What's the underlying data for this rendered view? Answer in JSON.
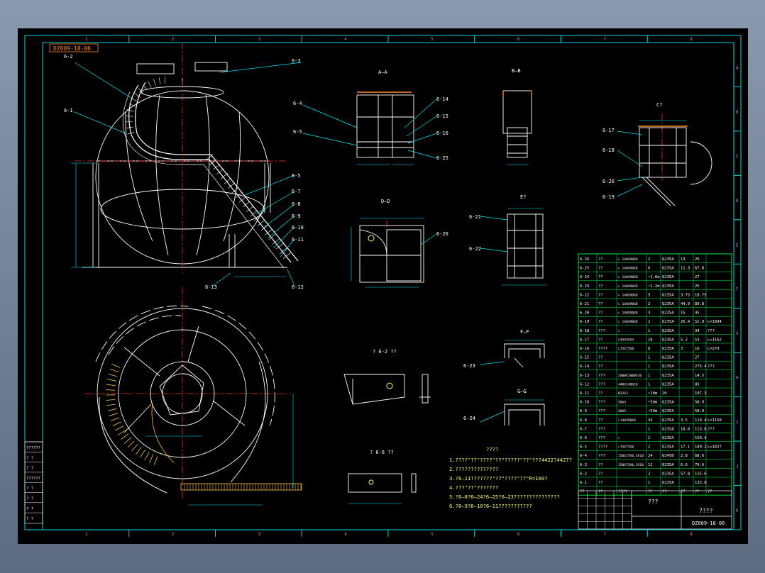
{
  "drawing": {
    "number": "DZ009-18-06",
    "title_main": "???",
    "title_sub": "????",
    "border_letters_right": [
      "A",
      "B",
      "C",
      "D",
      "E",
      "F",
      "G",
      "H",
      "I",
      "J",
      "K"
    ],
    "border_numbers_top": [
      "1",
      "2",
      "3",
      "4",
      "5",
      "6",
      "7",
      "8"
    ]
  },
  "views": {
    "aa": "A—A",
    "bb": "B—B",
    "c": "C?",
    "dd": "D—D",
    "e": "E?",
    "ff": "F—F",
    "gg": "G—G",
    "part62": "? 6-2   ??",
    "part66": "? 6-6   ??"
  },
  "callouts": {
    "main": [
      "6-2",
      "6-1",
      "6-3",
      "6-5",
      "6-7",
      "6-8",
      "6-9",
      "6-10",
      "6-11",
      "6-12",
      "6-13"
    ],
    "aa": [
      "6-4",
      "6-5",
      "6-14",
      "6-15",
      "6-16",
      "6-25"
    ],
    "c": [
      "6-17",
      "6-18",
      "6-26",
      "6-19"
    ],
    "dd": [
      "6-20"
    ],
    "e": [
      "6-21",
      "6-22"
    ],
    "ff": [
      "6-23"
    ],
    "gg": [
      "6-24"
    ]
  },
  "notes": {
    "heading": "????",
    "lines": [
      "1.????\"??\"????\"??\"?????\"??\"???4422?4427?",
      "2.??????????????",
      "3.?6—11???????\"??\"????\"??\"R=100?",
      "4.???\"??\"???????",
      "5.?6—8?6—24?6—25?6—23???????????????",
      "6.?6—9?6—10?6—11???????????"
    ]
  },
  "bom": {
    "rows": [
      [
        "6-26",
        "??",
        "∟ 140X90X8",
        "2",
        "Q235A",
        "13",
        "26",
        ""
      ],
      [
        "6-25",
        "??",
        "∟ 140X90X8",
        "6",
        "Q235A",
        "11.3",
        "67.8",
        ""
      ],
      [
        "6-24",
        "??",
        "∟ 140X90X8",
        "~1.6m",
        "Q235A",
        "",
        "27",
        ""
      ],
      [
        "6-23",
        "??",
        "∟ 140X90X8",
        "~1.2m",
        "Q235A",
        "",
        "25",
        ""
      ],
      [
        "6-22",
        "??",
        "∟ 140X90X8",
        "5",
        "Q235A",
        "3.75",
        "18.75",
        ""
      ],
      [
        "6-21",
        "??",
        "∟ 140X90X8",
        "2",
        "Q235A",
        "44.9",
        "89.8",
        ""
      ],
      [
        "6-20",
        "??",
        "∟ 140X90X8",
        "3",
        "Q235A",
        "15",
        "45",
        ""
      ],
      [
        "6-19",
        "??",
        "∟ 140X90X8",
        "2",
        "Q235A",
        "26.4",
        "52.8",
        "L=1894"
      ],
      [
        "6-18",
        "???",
        "∟",
        "1",
        "Q235A",
        "",
        "34",
        "???"
      ],
      [
        "6-17",
        "??",
        "∟45X45X4",
        "18",
        "Q235A",
        "5.2",
        "53",
        "L=1162"
      ],
      [
        "6-16",
        "????",
        "∟75X75X6",
        "8",
        "Q235A",
        "3",
        "16",
        "L=279"
      ],
      [
        "6-15",
        "??",
        "",
        "1",
        "Q235A",
        "",
        "27",
        ""
      ],
      [
        "6-14",
        "??",
        "",
        "1",
        "Q235A",
        "",
        "275.4",
        "???"
      ],
      [
        "6-13",
        "???",
        "2000X1000X10",
        "1",
        "Q235A",
        "",
        "14.5",
        ""
      ],
      [
        "6-12",
        "???",
        "440X140X10",
        "1",
        "Q235A",
        "",
        "83",
        ""
      ],
      [
        "6-11",
        "??",
        "Ø32X3",
        "~28m",
        "20",
        "",
        "107.3",
        ""
      ],
      [
        "6-10",
        "???",
        "50X5",
        "~50m",
        "Q235A",
        "",
        "58.9",
        ""
      ],
      [
        "6-9",
        "???",
        "50X5",
        "~50m",
        "Q235A",
        "",
        "58.9",
        ""
      ],
      [
        "6-8",
        "??",
        "∟140X90X8",
        "34",
        "Q235A",
        "3.5",
        "119.4",
        "L=1150"
      ],
      [
        "6-7",
        "???",
        "",
        "1",
        "Q235A",
        "18.8",
        "113.8",
        "???"
      ],
      [
        "6-6",
        "???",
        "∟",
        "1",
        "Q235A",
        "",
        "150.4",
        ""
      ],
      [
        "6-5",
        "????",
        "∟75X75X6",
        "2",
        "Q235A",
        "17.1",
        "189.2",
        "L=1827"
      ],
      [
        "6-4",
        "???",
        "150X75X6.5X10",
        "24",
        "Q345B",
        "2.8",
        "68.6",
        ""
      ],
      [
        "6-3",
        "??",
        "150X75X6.5X10",
        "12",
        "Q235A",
        "6.6",
        "79.6",
        ""
      ],
      [
        "6-2",
        "??",
        "",
        "2",
        "Q235A",
        "57.8",
        "115.6",
        ""
      ],
      [
        "6-1",
        "??",
        "",
        "1",
        "Q235A",
        "",
        "133.8",
        ""
      ]
    ],
    "header": [
      "??",
      "??",
      "????",
      "??",
      "??",
      "??",
      "??",
      "??"
    ]
  },
  "left_title_strip": [
    "??????",
    "? ?",
    "? ?",
    "??????",
    "? ?",
    "? ?",
    "? ?",
    "? ?"
  ],
  "colors": {
    "line": "#ffffff",
    "center": "#ff2a2a",
    "dim": "#00e6ff",
    "frame": "#00d8e0",
    "table": "#00ff3c",
    "text": "#ffff66",
    "orange": "#ff8a2a",
    "pink": "#ff66cc"
  }
}
